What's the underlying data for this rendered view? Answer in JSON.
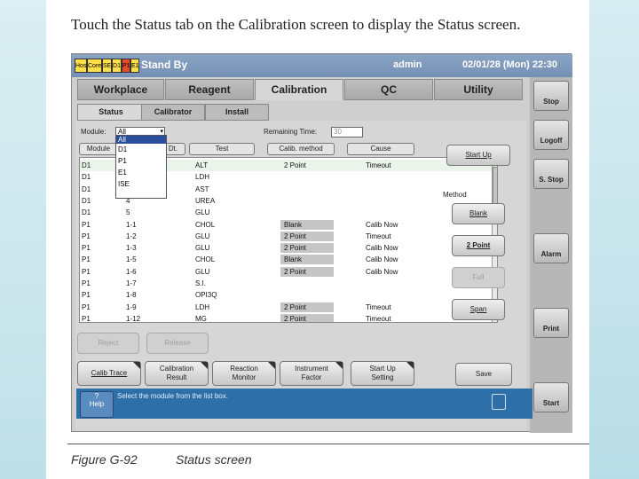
{
  "caption_top": "Touch the Status tab on the Calibration screen to display the Status screen.",
  "titlebar": {
    "indicators": [
      "Host",
      "Core",
      "SE",
      "D1",
      "P1",
      "E1"
    ],
    "status": "Stand By",
    "user": "admin",
    "datetime": "02/01/28 (Mon) 22:30"
  },
  "main_tabs": [
    "Workplace",
    "Reagent",
    "Calibration",
    "QC",
    "Utility"
  ],
  "sub_tabs": [
    "Status",
    "Calibrator",
    "Install"
  ],
  "filter": {
    "module_label": "Module:",
    "module_value": "All",
    "remaining_label": "Remaining Time:",
    "remaining_value": "30"
  },
  "dropdown_options": [
    "All",
    "D1",
    "P1",
    "E1",
    "ISE"
  ],
  "grid_headers": [
    "Module",
    "Dt.",
    "Test",
    "Calib. method",
    "Cause"
  ],
  "rows": [
    {
      "module": "D1",
      "num": "",
      "test": "ALT",
      "method": "2 Point",
      "cause": "Timeout"
    },
    {
      "module": "D1",
      "num": "",
      "test": "LDH",
      "method": "",
      "cause": ""
    },
    {
      "module": "D1",
      "num": "",
      "test": "AST",
      "method": "",
      "cause": ""
    },
    {
      "module": "D1",
      "num": "4",
      "test": "UREA",
      "method": "",
      "cause": ""
    },
    {
      "module": "D1",
      "num": "5",
      "test": "GLU",
      "method": "",
      "cause": ""
    },
    {
      "module": "P1",
      "num": "1-1",
      "test": "CHOL",
      "method": "Blank",
      "cause": "Calib Now"
    },
    {
      "module": "P1",
      "num": "1-2",
      "test": "GLU",
      "method": "2 Point",
      "cause": "Timeout"
    },
    {
      "module": "P1",
      "num": "1-3",
      "test": "GLU",
      "method": "2 Point",
      "cause": "Calib Now"
    },
    {
      "module": "P1",
      "num": "1-5",
      "test": "CHOL",
      "method": "Blank",
      "cause": "Calib Now"
    },
    {
      "module": "P1",
      "num": "1-6",
      "test": "GLU",
      "method": "2 Point",
      "cause": "Calib Now"
    },
    {
      "module": "P1",
      "num": "1-7",
      "test": "S.I.",
      "method": "",
      "cause": ""
    },
    {
      "module": "P1",
      "num": "1-8",
      "test": "OPI3Q",
      "method": "",
      "cause": ""
    },
    {
      "module": "P1",
      "num": "1-9",
      "test": "LDH",
      "method": "2 Point",
      "cause": "Timeout"
    },
    {
      "module": "P1",
      "num": "1-12",
      "test": "MG",
      "method": "2 Point",
      "cause": "Timeout"
    }
  ],
  "buttons": {
    "start_up": "Start Up",
    "method_label": "Method",
    "blank": "Blank",
    "two_point": "2 Point",
    "full": "Full",
    "span": "Span",
    "save": "Save",
    "reject": "Reject",
    "release": "Release",
    "calib_trace": "Calib Trace",
    "calib_result_1": "Calibration",
    "calib_result_2": "Result",
    "reaction_1": "Reaction",
    "reaction_2": "Monitor",
    "instrument_1": "Instrument",
    "instrument_2": "Factor",
    "startup_setting_1": "Start Up",
    "startup_setting_2": "Setting"
  },
  "side_buttons": [
    "Stop",
    "Logoff",
    "S. Stop",
    "Alarm",
    "Print",
    "Start"
  ],
  "message": "Select the module from the list box.",
  "help": {
    "q": "?",
    "label": "Help"
  },
  "caption_bottom": {
    "figure": "Figure G-92",
    "title": "Status screen"
  },
  "colors": {
    "titlebar": "#7f9abc",
    "message_bar": "#2f6fa8",
    "selected_row": "#eaf4ea"
  }
}
